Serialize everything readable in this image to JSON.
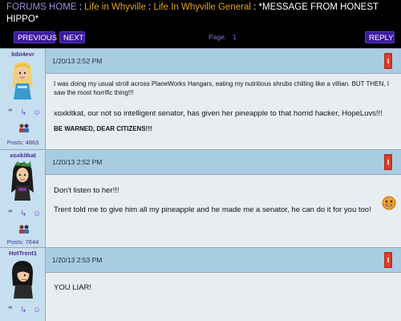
{
  "breadcrumb": {
    "home": "FORUMS HOME",
    "sep1": ":",
    "forum": "Life in Whyville",
    "sep2": ":",
    "subforum": "Life In Whyville General",
    "sep3": ":",
    "topic": "*MESSAGE FROM HONEST HIPPO*"
  },
  "nav": {
    "previous": "PREVIOUS",
    "next": "NEXT",
    "page_label": "Page:",
    "page_number": "1",
    "reply": "REPLY"
  },
  "posts": [
    {
      "username": "bibi4evr",
      "date": "1/20/13 2:52 PM",
      "posts_count": "Posts: 4863",
      "lines": [
        "I was doing my usual stroll across PlaneWorks Hangars, eating my nutritious shrubs chilling like a villian. BUT THEN, I saw the most horrific thing!!!",
        "xoxkitkat, our not so intelligent senator, has given her pineapple to that horrid hacker, HopeLuvs!!!",
        "BE WARNED, DEAR CITIZENS!!!"
      ]
    },
    {
      "username": "xoxkitkat",
      "date": "1/20/13 2:52 PM",
      "posts_count": "Posts: 7644",
      "lines": [
        "Don't listen to her!!!",
        "Trent told me to give him all my pineapple and he made me a senator, he can do it for you too!"
      ]
    },
    {
      "username": "HotTrent1",
      "date": "1/20/13 2:53 PM",
      "lines": [
        "YOU LIAR!"
      ]
    }
  ],
  "colors": {
    "nav_button": "#3c1a9c",
    "header_bar": "#a8cde3",
    "sidebar": "#c6dff0",
    "post_body": "#e9edf2",
    "breadcrumb_link": "#e8a020",
    "breadcrumb_home": "#a08cd8"
  },
  "icons": [
    "quote-icon",
    "reply-arrow-icon",
    "user-card-icon",
    "friends-icon",
    "smiley-emote-icon"
  ]
}
